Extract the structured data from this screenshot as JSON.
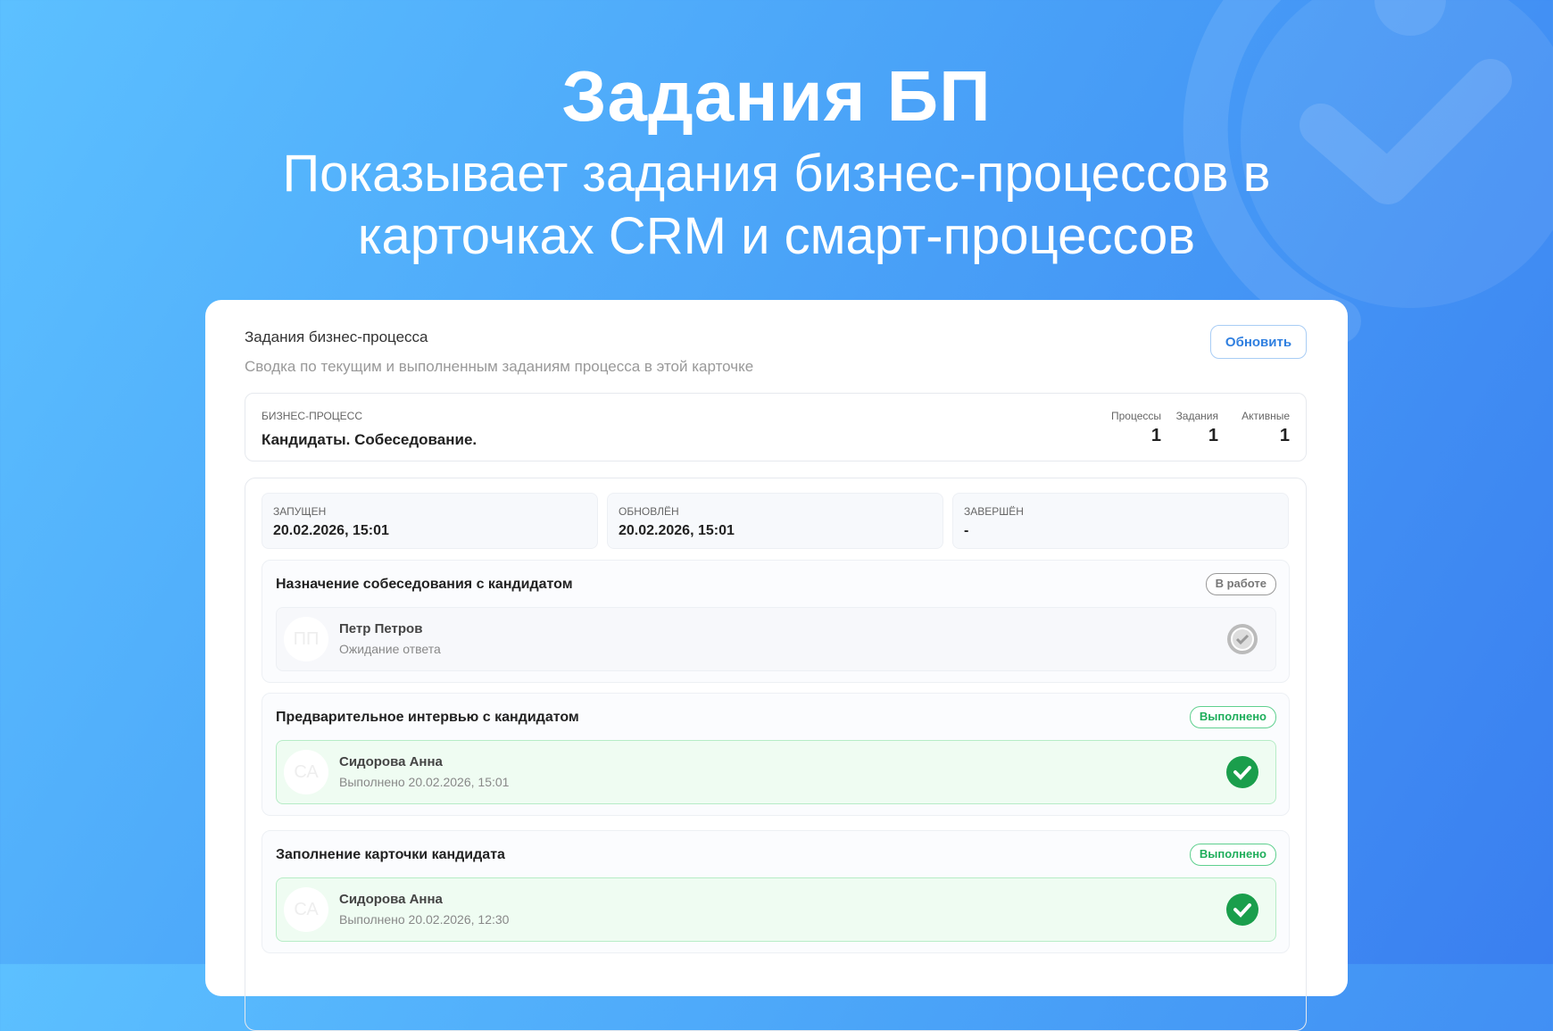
{
  "hero": {
    "title": "Задания БП",
    "subtitle_line1": "Показывает задания бизнес-процессов в",
    "subtitle_line2": "карточках CRM и смарт-процессов"
  },
  "panel": {
    "title": "Задания бизнес-процесса",
    "subtitle": "Сводка по текущим и выполненным заданиям процесса в этой карточке",
    "refresh_label": "Обновить"
  },
  "process": {
    "label": "БИЗНЕС-ПРОЦЕСС",
    "name": "Кандидаты. Собеседование.",
    "stats": [
      {
        "label": "Процессы",
        "value": "1"
      },
      {
        "label": "Задания",
        "value": "1"
      },
      {
        "label": "Активные",
        "value": "1"
      }
    ]
  },
  "dates": [
    {
      "label": "ЗАПУЩЕН",
      "value": "20.02.2026, 15:01"
    },
    {
      "label": "ОБНОВЛЁН",
      "value": "20.02.2026, 15:01"
    },
    {
      "label": "ЗАВЕРШЁН",
      "value": "-"
    }
  ],
  "tasks": [
    {
      "title": "Назначение собеседования с кандидатом",
      "status": "В работе",
      "initials": "ПП",
      "user": "Петр Петров",
      "detail": "Ожидание ответа",
      "icon": "clock-check-icon"
    },
    {
      "title": "Предварительное интервью с кандидатом",
      "status": "Выполнено",
      "initials": "СА",
      "user": "Сидорова Анна",
      "detail": "Выполнено 20.02.2026, 15:01",
      "icon": "check-circle-icon"
    },
    {
      "title": "Заполнение карточки кандидата",
      "status": "Выполнено",
      "initials": "СА",
      "user": "Сидорова Анна",
      "detail": "Выполнено 20.02.2026, 12:30",
      "icon": "check-circle-icon"
    }
  ],
  "colors": {
    "accent": "#2f7fe0",
    "success": "#1a9e4c"
  }
}
